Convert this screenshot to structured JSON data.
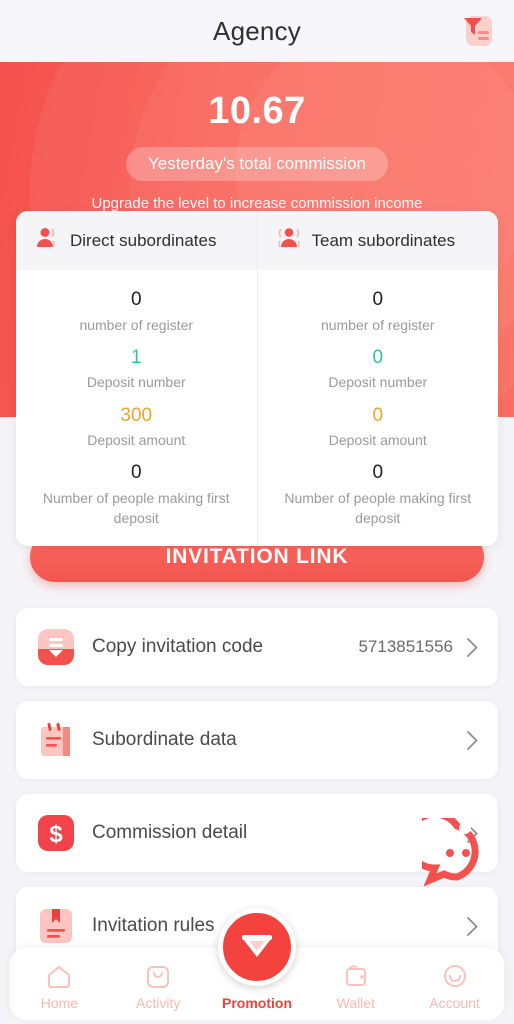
{
  "header": {
    "title": "Agency",
    "report_icon": "report-filter-icon"
  },
  "hero": {
    "amount": "10.67",
    "pill_label": "Yesterday's total commission",
    "subtitle": "Upgrade the level to increase commission income",
    "bg_color": "#f4514e"
  },
  "stats": {
    "columns": [
      {
        "icon": "person-icon",
        "title": "Direct subordinates",
        "rows": [
          {
            "value": "0",
            "label": "number of register",
            "color": "#1f1f1f"
          },
          {
            "value": "1",
            "label": "Deposit number",
            "color": "#2fc39b"
          },
          {
            "value": "300",
            "label": "Deposit amount",
            "color": "#f0a32e"
          },
          {
            "value": "0",
            "label": "Number of people making first deposit",
            "color": "#1f1f1f"
          }
        ]
      },
      {
        "icon": "people-group-icon",
        "title": "Team subordinates",
        "rows": [
          {
            "value": "0",
            "label": "number of register",
            "color": "#1f1f1f"
          },
          {
            "value": "0",
            "label": "Deposit number",
            "color": "#2fc39b"
          },
          {
            "value": "0",
            "label": "Deposit amount",
            "color": "#f0a32e"
          },
          {
            "value": "0",
            "label": "Number of people making first deposit",
            "color": "#1f1f1f"
          }
        ]
      }
    ]
  },
  "invite_button": {
    "label": "INVITATION LINK"
  },
  "list": {
    "items": [
      {
        "icon": "inbox-tray-icon",
        "label": "Copy invitation code",
        "value": "5713851556"
      },
      {
        "icon": "notepad-icon",
        "label": "Subordinate data",
        "value": ""
      },
      {
        "icon": "dollar-badge-icon",
        "label": "Commission detail",
        "value": ""
      },
      {
        "icon": "bookmark-book-icon",
        "label": "Invitation rules",
        "value": ""
      }
    ]
  },
  "support": {
    "icon": "chat-support-icon"
  },
  "bottom_nav": {
    "items": [
      {
        "icon": "home-icon",
        "label": "Home",
        "active": false
      },
      {
        "icon": "activity-icon",
        "label": "Activity",
        "active": false
      },
      {
        "icon": "diamond-icon",
        "label": "Promotion",
        "active": true
      },
      {
        "icon": "wallet-icon",
        "label": "Wallet",
        "active": false
      },
      {
        "icon": "account-icon",
        "label": "Account",
        "active": false
      }
    ]
  }
}
